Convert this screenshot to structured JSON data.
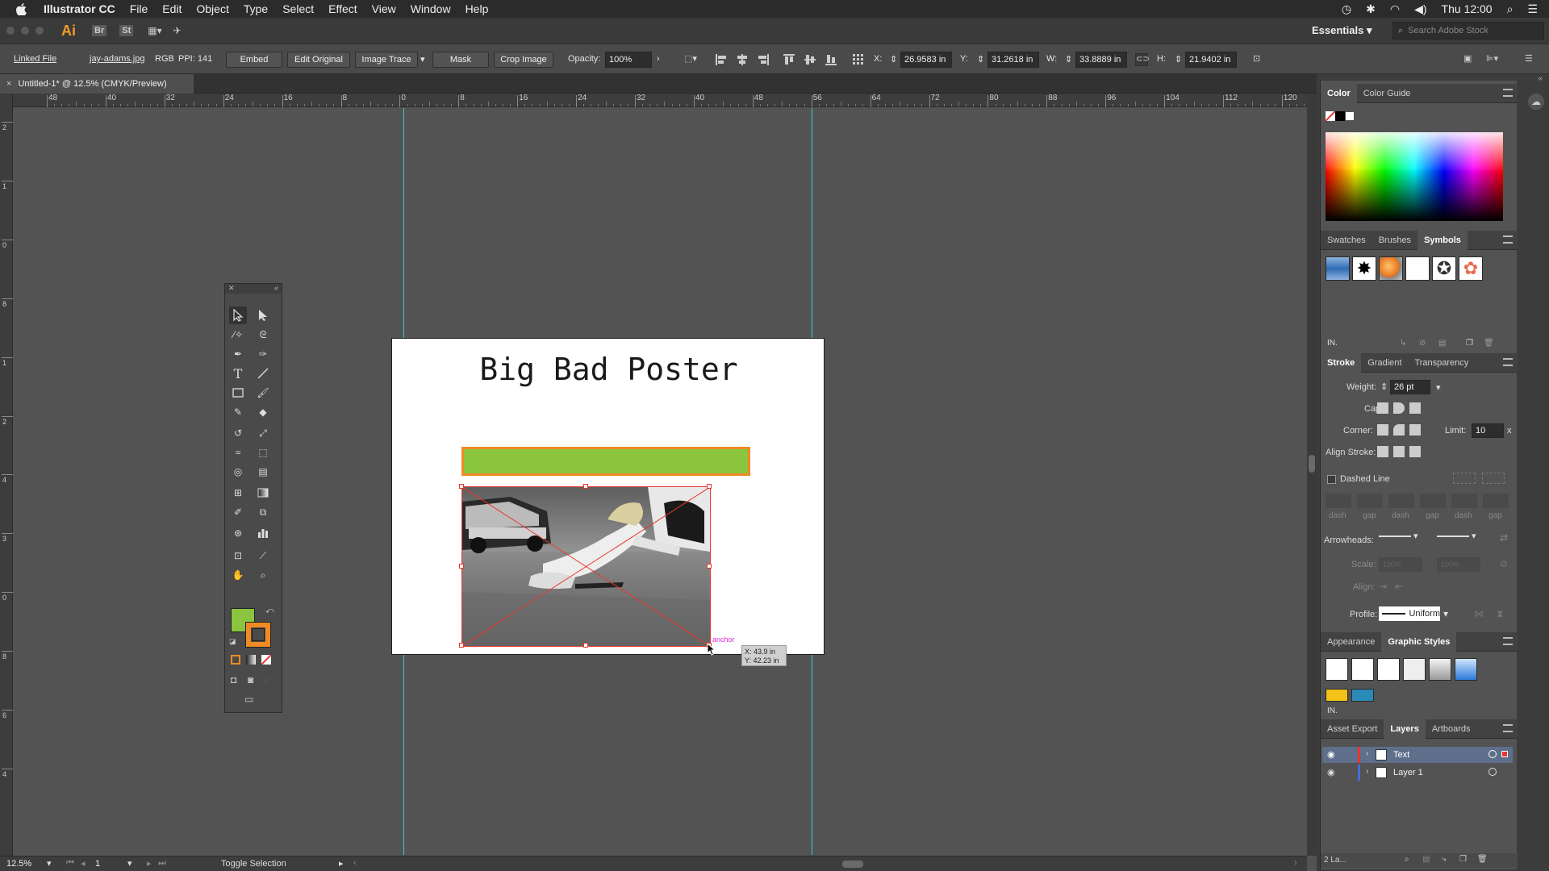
{
  "menubar": {
    "apple_icon": "apple-icon",
    "app_name": "Illustrator CC",
    "items": [
      "File",
      "Edit",
      "Object",
      "Type",
      "Select",
      "Effect",
      "View",
      "Window",
      "Help"
    ],
    "clock": "Thu 12:00"
  },
  "appbar": {
    "logo": "Ai",
    "bridge": "Br",
    "stock": "St",
    "workspace": "Essentials",
    "search_placeholder": "Search Adobe Stock"
  },
  "control": {
    "linked_file": "Linked File",
    "filename": "jay-adams.jpg",
    "color_mode": "RGB",
    "ppi": "PPI: 141",
    "embed": "Embed",
    "edit_original": "Edit Original",
    "image_trace": "Image Trace",
    "mask": "Mask",
    "crop_image": "Crop Image",
    "opacity_label": "Opacity:",
    "opacity_value": "100%",
    "x_label": "X:",
    "x_value": "26.9583 in",
    "y_label": "Y:",
    "y_value": "31.2618 in",
    "w_label": "W:",
    "w_value": "33.8889 in",
    "h_label": "H:",
    "h_value": "21.9402 in"
  },
  "document": {
    "tab_title": "Untitled-1* @ 12.5% (CMYK/Preview)",
    "close": "×"
  },
  "rulers": {
    "h_ticks": [
      "48",
      "40",
      "32",
      "24",
      "16",
      "8",
      "0",
      "8",
      "16",
      "24",
      "32",
      "40",
      "48",
      "56",
      "64",
      "72",
      "80",
      "88",
      "96",
      "104",
      "112",
      "120"
    ],
    "v_ticks": [
      "2",
      "1",
      "0",
      "8",
      "1",
      "2",
      "4",
      "3",
      "0",
      "8",
      "6",
      "4"
    ]
  },
  "artboard": {
    "title": "Big Bad Poster",
    "anchor_label": "anchor",
    "tooltip_x": "X: 43.9 in",
    "tooltip_y": "Y: 42.23 in"
  },
  "colors": {
    "fill": "#8bc540",
    "stroke": "#f08a24",
    "guide": "#3cc6d8",
    "selection": "#e8362d",
    "anchor": "#e02ad8"
  },
  "panels": {
    "color_tabs": [
      "Color",
      "Color Guide"
    ],
    "symbols_tabs": [
      "Swatches",
      "Brushes",
      "Symbols"
    ],
    "stroke_tabs": [
      "Stroke",
      "Gradient",
      "Transparency"
    ],
    "weight_label": "Weight:",
    "weight_value": "26 pt",
    "cap_label": "Cap:",
    "corner_label": "Corner:",
    "limit_label": "Limit:",
    "limit_value": "10",
    "limit_unit": "x",
    "align_stroke_label": "Align Stroke:",
    "dashed_line": "Dashed Line",
    "dash_labels": [
      "dash",
      "gap",
      "dash",
      "gap",
      "dash",
      "gap"
    ],
    "arrowheads_label": "Arrowheads:",
    "scale_label": "Scale:",
    "scale_value1": "100%",
    "scale_value2": "100%",
    "align_label": "Align:",
    "profile_label": "Profile:",
    "profile_value": "Uniform",
    "appearance_tabs": [
      "Appearance",
      "Graphic Styles"
    ],
    "layers_tabs": [
      "Asset Export",
      "Layers",
      "Artboards"
    ],
    "layers": [
      {
        "name": "Text",
        "color": "#e8362d"
      },
      {
        "name": "Layer 1",
        "color": "#4a6cd8"
      }
    ],
    "layers_count": "2 La..."
  },
  "status": {
    "zoom": "12.5%",
    "artboard_num": "1",
    "mode": "Toggle Selection"
  }
}
